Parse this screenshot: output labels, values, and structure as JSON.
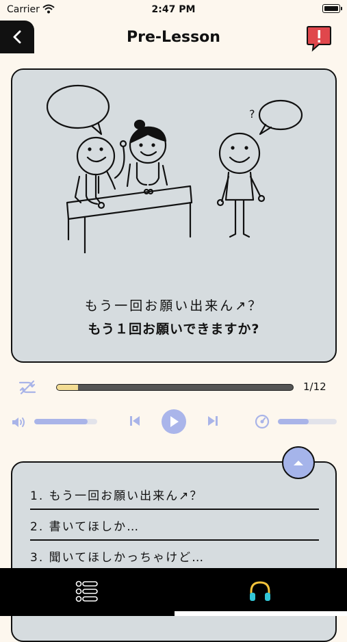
{
  "status": {
    "carrier": "Carrier",
    "time": "2:47 PM"
  },
  "header": {
    "title": "Pre-Lesson"
  },
  "card": {
    "phrase_casual": "もう一回お願い出来ん↗？",
    "phrase_polite": "もう１回お願いできますか?"
  },
  "player": {
    "counter": "1/12",
    "progress": 0.09,
    "volume": 0.85,
    "speed": 0.52
  },
  "list": {
    "items": [
      {
        "num": "1.",
        "text": "もう一回お願い出来ん↗？"
      },
      {
        "num": "2.",
        "text": "書いてほしか…"
      },
      {
        "num": "3.",
        "text": "聞いてほしかっちゃけど…"
      }
    ]
  },
  "icons": {
    "back": "chevron-left-icon",
    "report": "report-speech-bubble-icon",
    "shuffle": "shuffle-icon",
    "volume": "speaker-icon",
    "prev": "skip-previous-icon",
    "play": "play-icon",
    "next": "skip-next-icon",
    "speed": "speed-gauge-icon",
    "collapse": "chevron-up-icon",
    "tab_list": "list-icon",
    "tab_audio": "headphones-icon"
  },
  "colors": {
    "accent": "#a9b4e8",
    "progress": "#f3dc93",
    "report": "#e0474c",
    "card": "#d6dcdf",
    "background": "#fdf7ee"
  }
}
